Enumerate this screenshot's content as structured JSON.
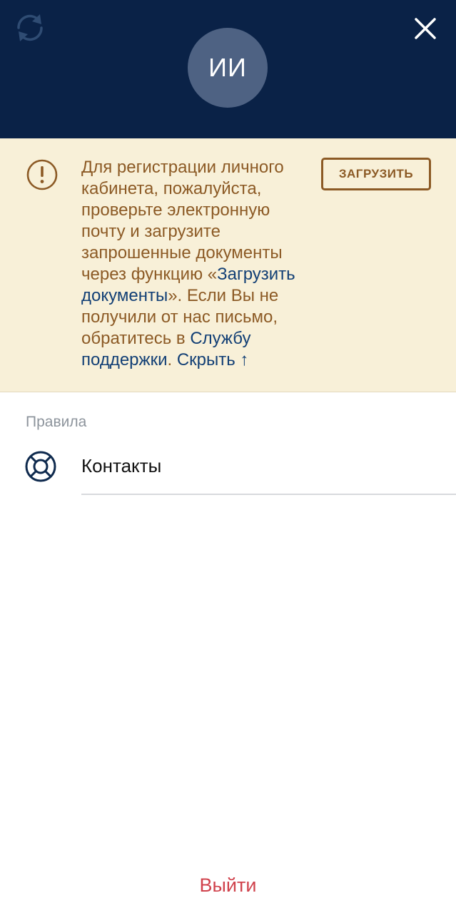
{
  "header": {
    "avatar_initials": "ИИ",
    "refresh_icon": "refresh-icon",
    "close_icon": "close-icon"
  },
  "notice": {
    "icon": "exclamation-circle-icon",
    "text_part1": "Для регистрации личного кабинета, пожалуйста, проверьте электронную почту и загрузите запрошенные документы через функцию «",
    "upload_link": "Загрузить документы",
    "text_part2": "». Если Вы не получили от нас письмо, обратитесь в ",
    "support_link": "Службу поддержки",
    "text_part3": ". ",
    "hide_link": "Скрыть ↑",
    "button_label": "ЗАГРУЗИТЬ"
  },
  "menu": {
    "section_label": "Правила",
    "items": [
      {
        "label": "Контакты",
        "icon": "lifebuoy-icon"
      }
    ]
  },
  "footer": {
    "logout_label": "Выйти"
  },
  "colors": {
    "header_bg": "#0a2247",
    "avatar_bg": "#4e6283",
    "notice_bg": "#f8f0d8",
    "notice_text": "#8c5a25",
    "link": "#123f75",
    "logout": "#d0424c"
  }
}
